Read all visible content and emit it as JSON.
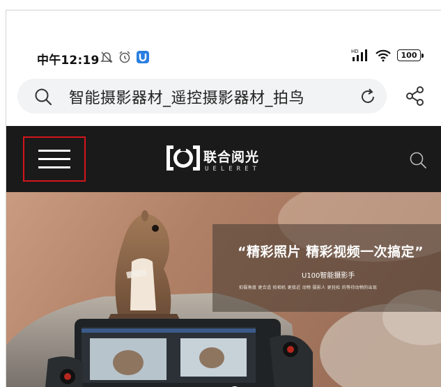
{
  "status_bar": {
    "time": "中午12:19",
    "battery": "100",
    "network": "HD",
    "icons": [
      "mute-alarm-icon",
      "alarm-clock-icon",
      "app-notification-icon",
      "signal-icon",
      "wifi-icon",
      "battery-icon"
    ]
  },
  "browser": {
    "url_text": "智能摄影器材_遥控摄影器材_拍鸟",
    "icons": [
      "search-icon",
      "reload-icon",
      "share-icon"
    ]
  },
  "site": {
    "logo_cn": "联合阅光",
    "logo_en": "UELERET",
    "icons": [
      "hamburger-menu-icon",
      "site-search-icon"
    ]
  },
  "hero": {
    "slogan": "“精彩照片 精彩视频一次搞定”",
    "product": "U100智能摄影手",
    "description": "拍摄角度 更合适    拍相机 更接近 动物    摄影人 更轻松 的等待动物的出现"
  },
  "colors": {
    "header_bg": "#1a1a1a",
    "highlight_box": "#d3151d",
    "url_bar_bg": "#f1f3f4"
  }
}
